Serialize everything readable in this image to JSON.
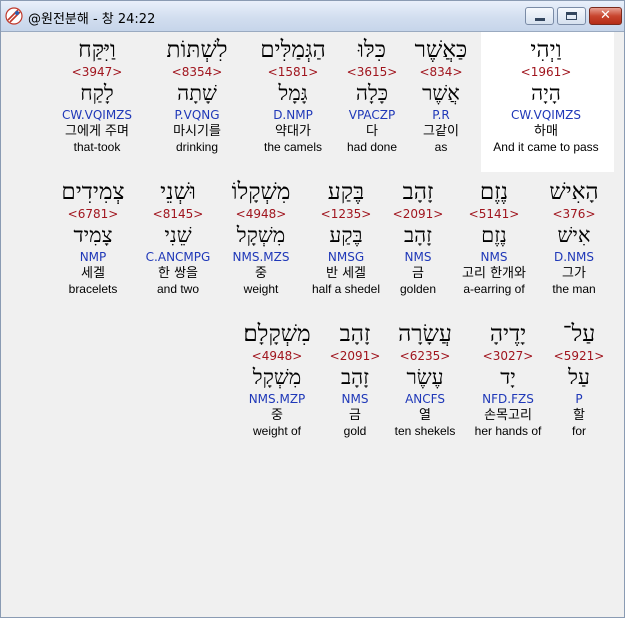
{
  "window": {
    "title": "@원전분해 - 창 24:22",
    "close_glyph": "✕"
  },
  "rows": [
    [
      {
        "heb": "וַיְהִי",
        "strong": "<1961>",
        "lemma": "הָיָה",
        "parse": "CW.VQIMZS",
        "kor": "하매",
        "eng": "And it came to pass"
      },
      {
        "heb": "כַּאֲשֶׁר",
        "strong": "<834>",
        "lemma": "אֲשֶׁר",
        "parse": "P.R",
        "kor": "그같이",
        "eng": "as"
      },
      {
        "heb": "כִּלּוּ",
        "strong": "<3615>",
        "lemma": "כָּלָה",
        "parse": "VPACZP",
        "kor": "다",
        "eng": "had done"
      },
      {
        "heb": "הַגְּמַלִּים",
        "strong": "<1581>",
        "lemma": "גָּמָל",
        "parse": "D.NMP",
        "kor": "약대가",
        "eng": "the camels"
      },
      {
        "heb": "לִשְׁתּוֹת",
        "strong": "<8354>",
        "lemma": "שָׁתָה",
        "parse": "P.VQNG",
        "kor": "마시기를",
        "eng": "drinking"
      },
      {
        "heb": "וַיִּקַּח",
        "strong": "<3947>",
        "lemma": "לָקַח",
        "parse": "CW.VQIMZS",
        "kor": "그에게 주며",
        "eng": "that-took"
      }
    ],
    [
      {
        "heb": "הָאִישׁ",
        "strong": "<376>",
        "lemma": "אִישׁ",
        "parse": "D.NMS",
        "kor": "그가",
        "eng": "the man"
      },
      {
        "heb": "נֶזֶם",
        "strong": "<5141>",
        "lemma": "נֶזֶם",
        "parse": "NMS",
        "kor": "고리 한개와",
        "eng": "a-earring of"
      },
      {
        "heb": "זָהָב",
        "strong": "<2091>",
        "lemma": "זָהָב",
        "parse": "NMS",
        "kor": "금",
        "eng": "golden"
      },
      {
        "heb": "בֶּקַע",
        "strong": "<1235>",
        "lemma": "בֶּקַע",
        "parse": "NMSG",
        "kor": "반 세겔",
        "eng": "half a shedel"
      },
      {
        "heb": "מִשְׁקָלוֹ",
        "strong": "<4948>",
        "lemma": "מִשְׁקָל",
        "parse": "NMS.MZS",
        "kor": "중",
        "eng": "weight"
      },
      {
        "heb": "וּשְׁנֵי",
        "strong": "<8145>",
        "lemma": "שֵׁנִי",
        "parse": "C.ANCMPG",
        "kor": "한 쌍을",
        "eng": "and two"
      },
      {
        "heb": "צְמִידִים",
        "strong": "<6781>",
        "lemma": "צָמִיד",
        "parse": "NMP",
        "kor": "세겔",
        "eng": "bracelets"
      }
    ],
    [
      {
        "heb": "עַל־",
        "strong": "<5921>",
        "lemma": "עַל",
        "parse": "P",
        "kor": "할",
        "eng": "for"
      },
      {
        "heb": "יָדֶיהָ",
        "strong": "<3027>",
        "lemma": "יָד",
        "parse": "NFD.FZS",
        "kor": "손목고리",
        "eng": "her hands of"
      },
      {
        "heb": "עֲשָׂרָה",
        "strong": "<6235>",
        "lemma": "עֶשֶׂר",
        "parse": "ANCFS",
        "kor": "열",
        "eng": "ten shekels"
      },
      {
        "heb": "זָהָב",
        "strong": "<2091>",
        "lemma": "זָהָב",
        "parse": "NMS",
        "kor": "금",
        "eng": "gold"
      },
      {
        "heb": "מִשְׁקָלָם׃",
        "strong": "<4948>",
        "lemma": "מִשְׁקָל",
        "parse": "NMS.MZP",
        "kor": "중",
        "eng": "weight of"
      }
    ]
  ]
}
